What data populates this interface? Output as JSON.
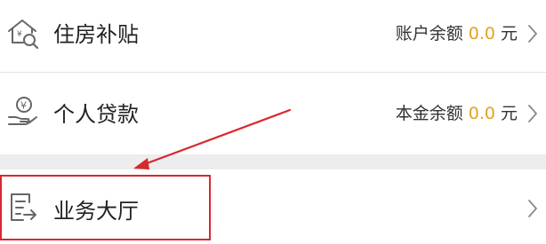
{
  "menu": {
    "items": [
      {
        "title": "住房补贴",
        "meta_label": "账户余额",
        "meta_value": "0.0",
        "meta_unit": "元",
        "icon": "housing-subsidy-icon"
      },
      {
        "title": "个人贷款",
        "meta_label": "本金余额",
        "meta_value": "0.0",
        "meta_unit": "元",
        "icon": "loan-hand-coin-icon"
      },
      {
        "title": "业务大厅",
        "icon": "document-arrow-icon"
      }
    ]
  },
  "colors": {
    "amount": "#e4a21e",
    "annotation": "#d9272e",
    "separator": "#ededed"
  }
}
